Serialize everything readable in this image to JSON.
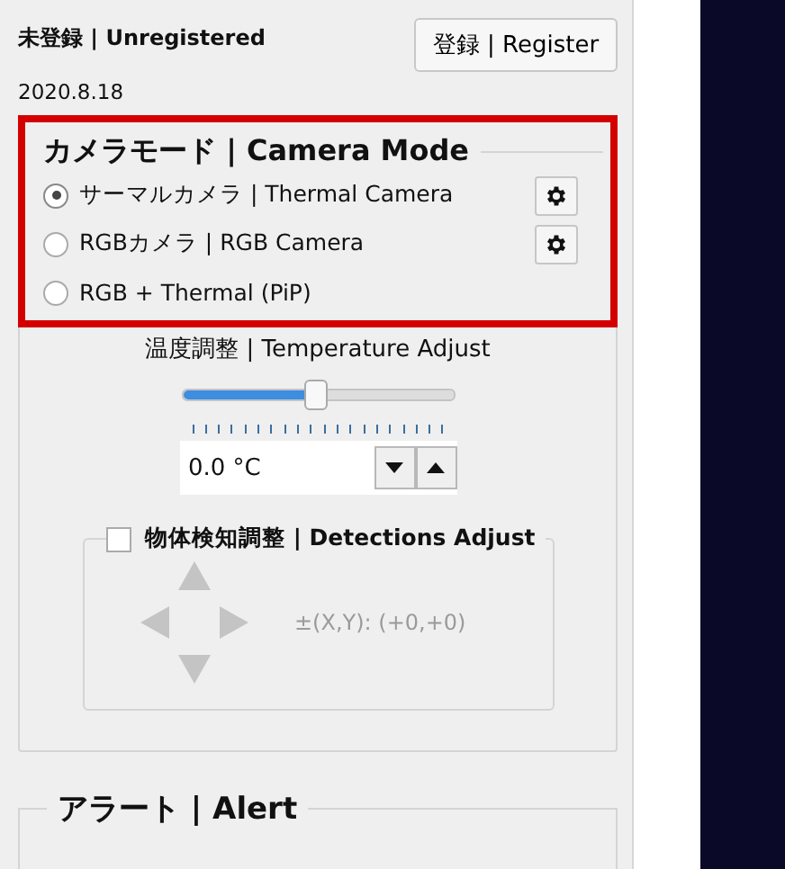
{
  "status": {
    "registration": "未登録 | Unregistered",
    "version": "2020.8.18"
  },
  "register_button": "登録 | Register",
  "camera_mode": {
    "title": "カメラモード | Camera Mode",
    "highlighted": true,
    "options": [
      {
        "label": "サーマルカメラ | Thermal Camera",
        "selected": true,
        "settings_button": true
      },
      {
        "label": "RGBカメラ | RGB Camera",
        "selected": false,
        "settings_button": true
      },
      {
        "label": "RGB + Thermal (PiP)",
        "selected": false,
        "settings_button": false
      }
    ]
  },
  "temperature": {
    "label": "温度調整 | Temperature Adjust",
    "level": 0.5,
    "value": "0.0 °C"
  },
  "detections": {
    "label": "物体検知調整 | Detections Adjust",
    "checked": false,
    "disabled": true,
    "offset": "±(X,Y):  (+0,+0)"
  },
  "alert": {
    "title": "アラート | Alert"
  }
}
